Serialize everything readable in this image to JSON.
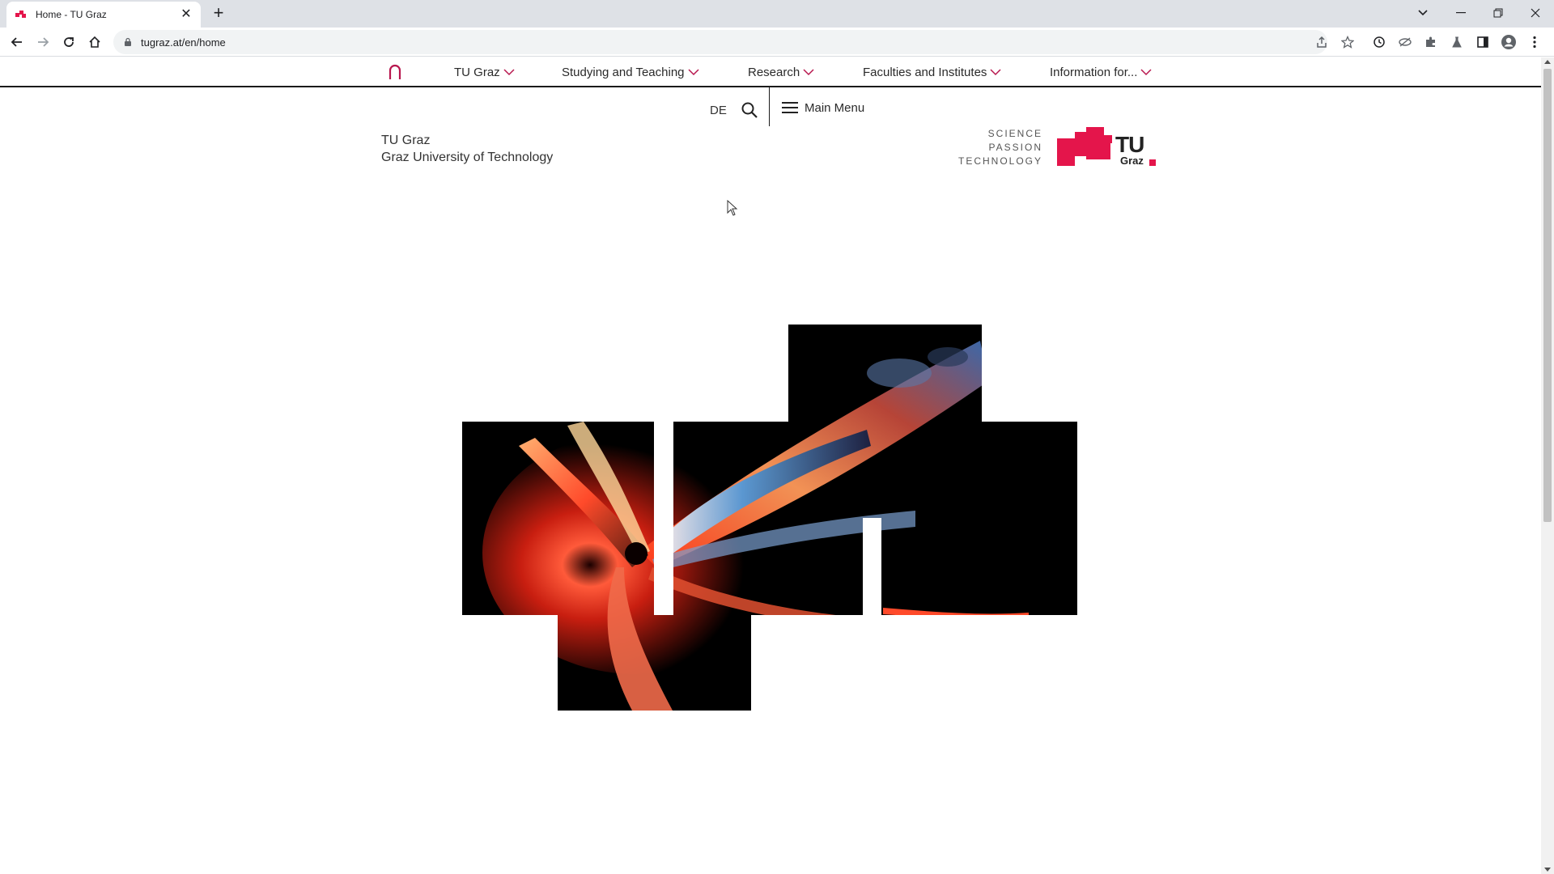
{
  "browser": {
    "tab": {
      "title": "Home - TU Graz",
      "close_icon": "close-icon"
    },
    "new_tab_icon": "plus-icon",
    "url": "tugraz.at/en/home",
    "window_controls": [
      "minimize-icon",
      "restore-icon",
      "close-icon"
    ],
    "extensions": [
      "share-icon",
      "star-icon",
      "history-icon",
      "extension-eye-icon",
      "puzzle-icon",
      "lab-flask-icon",
      "sidepanel-icon",
      "profile-icon",
      "kebab-menu-icon"
    ]
  },
  "site": {
    "nav": {
      "home_icon": "home-arch-icon",
      "items": [
        {
          "label": "TU Graz"
        },
        {
          "label": "Studying and Teaching"
        },
        {
          "label": "Research"
        },
        {
          "label": "Faculties and Institutes"
        },
        {
          "label": "Information for..."
        }
      ]
    },
    "util": {
      "language": "DE",
      "search_icon": "search-icon",
      "menu_label": "Main Menu"
    },
    "brand": {
      "line1": "TU Graz",
      "line2": "Graz University of Technology",
      "claim": [
        "SCIENCE",
        "PASSION",
        "TECHNOLOGY"
      ],
      "logo_text": "TU",
      "logo_subtext": "Graz"
    },
    "colors": {
      "accent": "#e4154b",
      "nav_text": "#2a2a2a",
      "nav_border": "#1b1b1b"
    }
  }
}
